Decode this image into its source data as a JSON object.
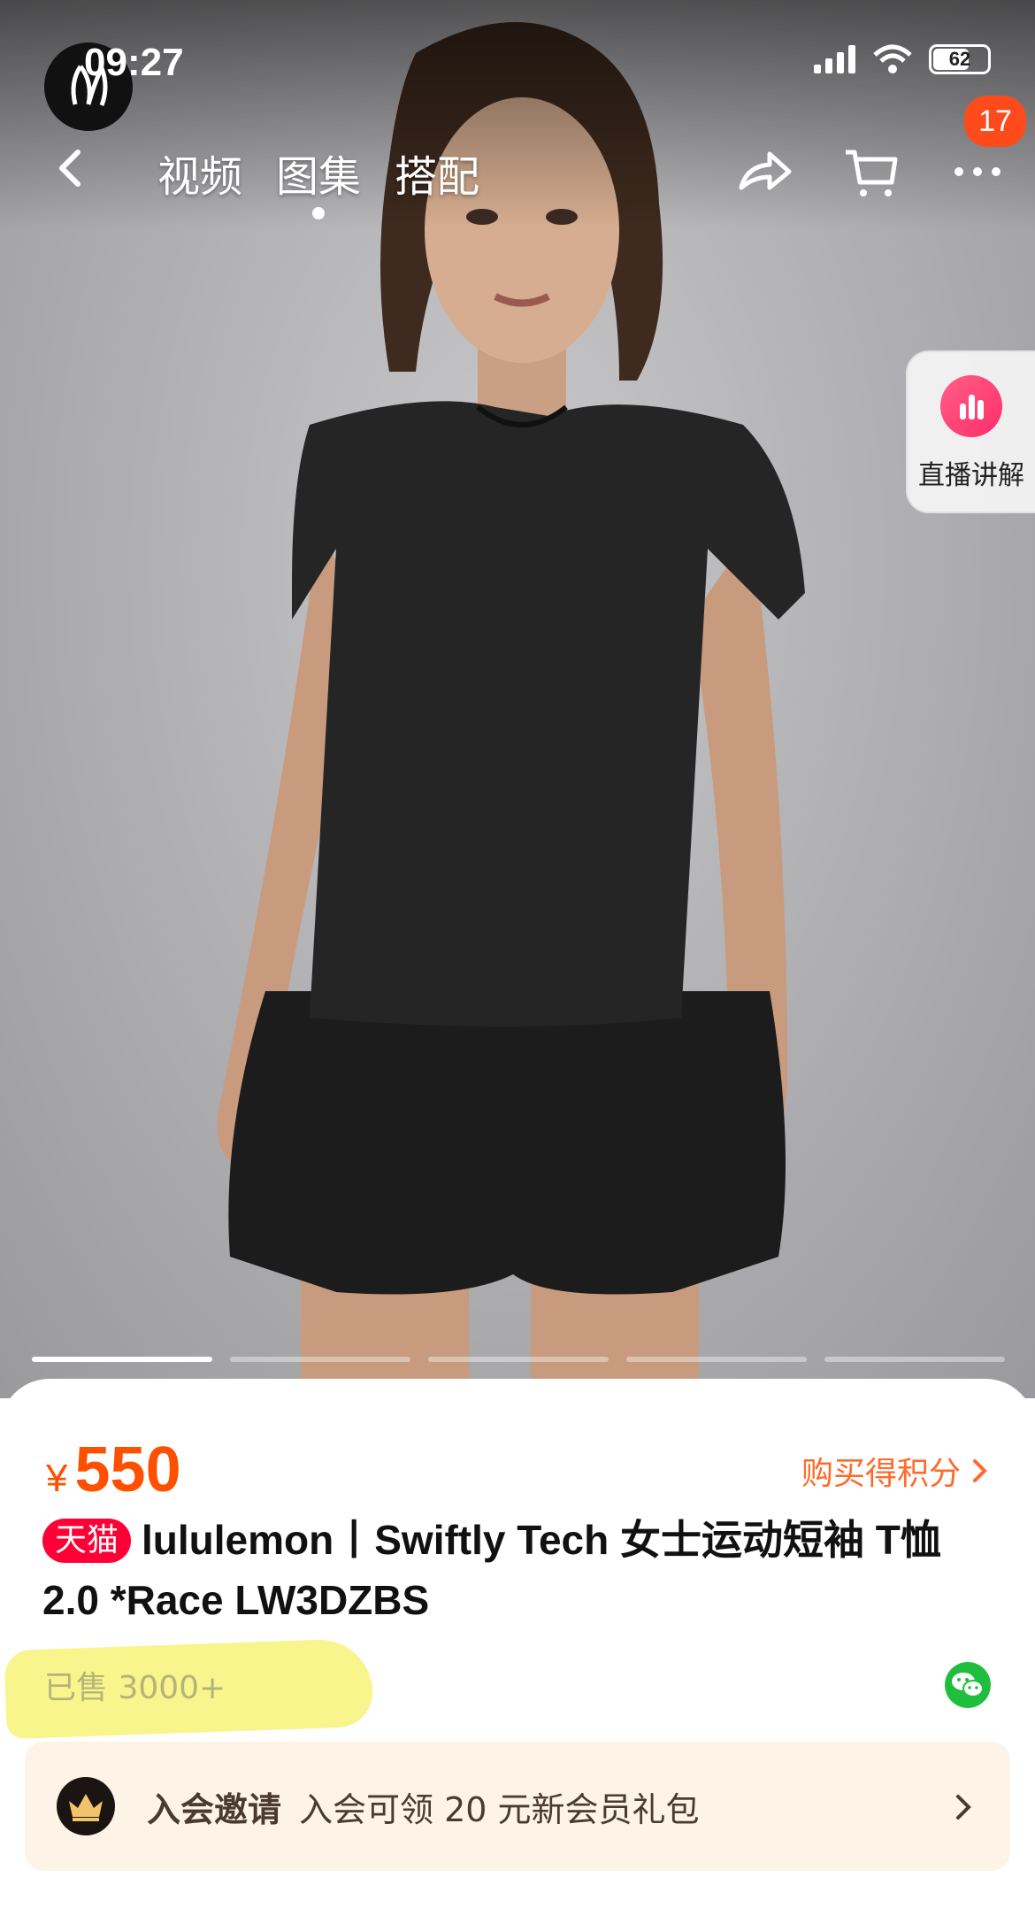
{
  "status_bar": {
    "time": "09:27",
    "battery": "62",
    "battery_level": 0.62
  },
  "nav": {
    "tabs": [
      {
        "label": "视频",
        "active": false
      },
      {
        "label": "图集",
        "active": true
      },
      {
        "label": "搭配",
        "active": false
      }
    ],
    "more_badge": "17",
    "icons": [
      "back-icon",
      "share-icon",
      "cart-icon",
      "more-icon"
    ]
  },
  "live_card": {
    "label": "直播讲解",
    "icon": "live-chart-icon"
  },
  "carousel": {
    "total_slides": 5,
    "active_index": 0
  },
  "product": {
    "currency": "¥",
    "price": "550",
    "points_link": "购买得积分",
    "tmall_badge": "天猫",
    "title": "lululemon丨Swiftly Tech 女士运动短袖 T恤 2.0 *Race LW3DZBS",
    "sold": "已售 3000+"
  },
  "member": {
    "title": "入会邀请",
    "desc": "入会可领 20 元新会员礼包"
  },
  "colors": {
    "accent": "#ff5000",
    "tmall": "#ff0036",
    "badge": "#ff4a1c",
    "member_bg": "#fdf3e6",
    "wechat": "#1fbf3d"
  }
}
